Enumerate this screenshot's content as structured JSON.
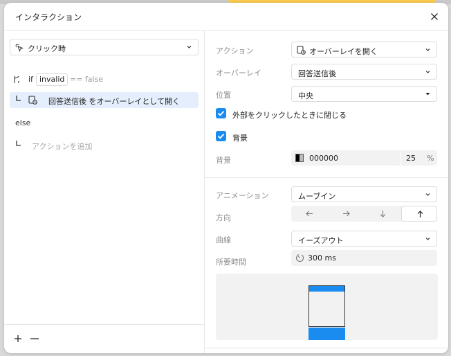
{
  "dialog": {
    "title": "インタラクション"
  },
  "left": {
    "trigger": {
      "label": "クリック時"
    },
    "if_keyword": "if",
    "condition": {
      "variable": "invalid",
      "comparison": "== false"
    },
    "action_item": {
      "label": "回答送信後 をオーバーレイとして開く"
    },
    "else_label": "else",
    "add_action_placeholder": "アクションを追加",
    "footer": {
      "add": "+",
      "remove": "−"
    }
  },
  "right": {
    "action": {
      "label": "アクション",
      "value": "オーバーレイを開く"
    },
    "overlay": {
      "label": "オーバーレイ",
      "value": "回答送信後"
    },
    "position": {
      "label": "位置",
      "value": "中央"
    },
    "close_on_outside_click": {
      "label": "外部をクリックしたときに閉じる",
      "checked": true
    },
    "background_toggle": {
      "label": "背景",
      "checked": true
    },
    "background": {
      "label": "背景",
      "color": "000000",
      "opacity": "25",
      "percent": "%"
    },
    "animation": {
      "label": "アニメーション",
      "value": "ムーブイン"
    },
    "direction": {
      "label": "方向",
      "options": [
        "left",
        "right",
        "down",
        "up"
      ],
      "selected": "up"
    },
    "curve": {
      "label": "曲線",
      "value": "イーズアウト"
    },
    "duration": {
      "label": "所要時間",
      "value": "300 ms"
    }
  },
  "colors": {
    "accent": "#1a8cf0",
    "highlight": "#e4eefc",
    "background_strip": "#f6c84c"
  }
}
